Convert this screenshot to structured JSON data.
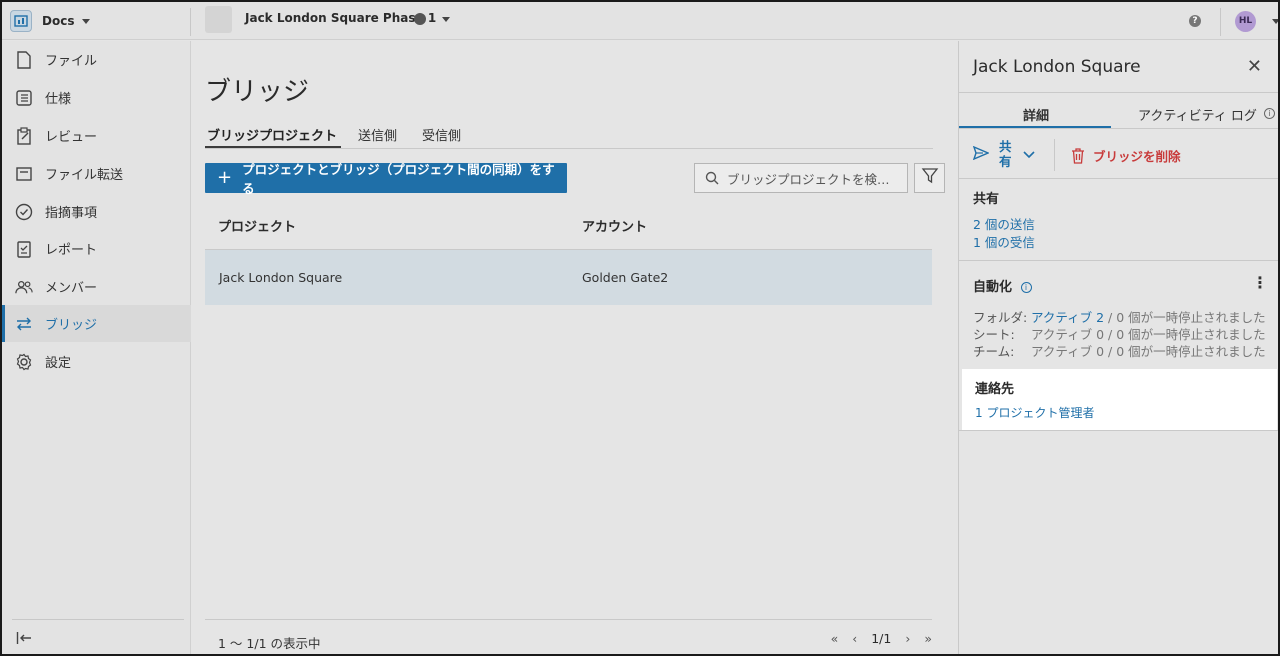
{
  "topbar": {
    "app_name": "Docs",
    "project_name": "Jack London Square Phase 1",
    "avatar_initials": "HL"
  },
  "sidebar": {
    "items": [
      {
        "label": "ファイル",
        "icon": "file-icon"
      },
      {
        "label": "仕様",
        "icon": "spec-list-icon"
      },
      {
        "label": "レビュー",
        "icon": "review-clipboard-icon"
      },
      {
        "label": "ファイル転送",
        "icon": "transmittal-tray-icon"
      },
      {
        "label": "指摘事項",
        "icon": "issue-check-icon"
      },
      {
        "label": "レポート",
        "icon": "report-clipboard-icon"
      },
      {
        "label": "メンバー",
        "icon": "members-icon"
      },
      {
        "label": "ブリッジ",
        "icon": "bridge-arrows-icon"
      },
      {
        "label": "設定",
        "icon": "gear-icon"
      }
    ],
    "active_index": 7
  },
  "main": {
    "title": "ブリッジ",
    "tabs": [
      "ブリッジプロジェクト",
      "送信側",
      "受信側"
    ],
    "add_button_label": "プロジェクトとブリッジ（プロジェクト間の同期）をする",
    "search_placeholder": "ブリッジプロジェクトを検…",
    "table": {
      "columns": [
        "プロジェクト",
        "アカウント"
      ],
      "rows": [
        [
          "Jack London Square",
          "Golden Gate2"
        ]
      ]
    },
    "footer_text": "1 ～ 1/1 の表示中",
    "page": "1/1"
  },
  "panel": {
    "title": "Jack London Square",
    "tabs": [
      "詳細",
      "アクティビティ ログ"
    ],
    "share_label": "共有",
    "delete_label": "ブリッジを削除",
    "share_section_title": "共有",
    "sent_link": "2 個の送信",
    "received_link": "1 個の受信",
    "automation_title": "自動化",
    "automation": [
      {
        "label": "フォルダ:",
        "active": "アクティブ 2",
        "rest": " / 0 個が一時停止されました"
      },
      {
        "label": "シート:",
        "active": "アクティブ 0",
        "rest": " / 0 個が一時停止されました"
      },
      {
        "label": "チーム:",
        "active": "アクティブ 0",
        "rest": " / 0 個が一時停止されました"
      }
    ],
    "contact_title": "連絡先",
    "contact_link": "1 プロジェクト管理者"
  },
  "colors": {
    "accent": "#1f6fa8",
    "danger": "#c83b3b",
    "selected_row": "#d2dbe1"
  }
}
